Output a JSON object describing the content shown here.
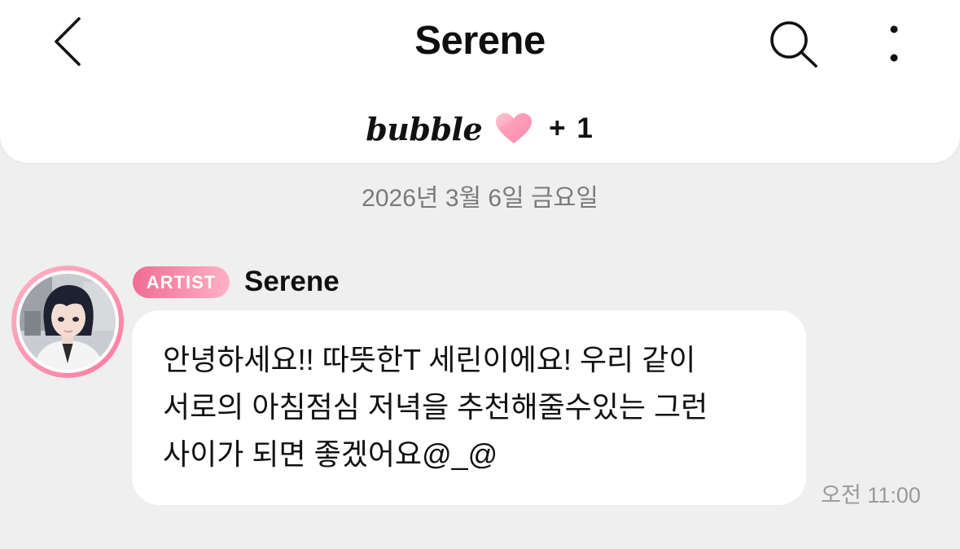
{
  "header": {
    "title": "Serene",
    "bubble_label": "bubble",
    "plus_count": "+ 1",
    "icons": {
      "back": "chevron-left-icon",
      "search": "search-icon",
      "more": "more-vertical-icon",
      "heart": "heart-icon"
    }
  },
  "date_separator": "2026년 3월 6일 금요일",
  "message": {
    "badge": "ARTIST",
    "sender": "Serene",
    "text": "안녕하세요!! 따뜻한T 세린이에요! 우리 같이 서로의 아침점심 저녁을 추천해줄수있는 그런 사이가 되면 좋겠어요@_@",
    "time": "오전 11:00"
  },
  "colors": {
    "background": "#efefef",
    "header": "#ffffff",
    "badge_start": "#f06c92",
    "badge_end": "#ffb1c8",
    "heart": "#ff9bb6",
    "muted_text": "#7a7a7a",
    "timestamp": "#9a9a9a"
  }
}
